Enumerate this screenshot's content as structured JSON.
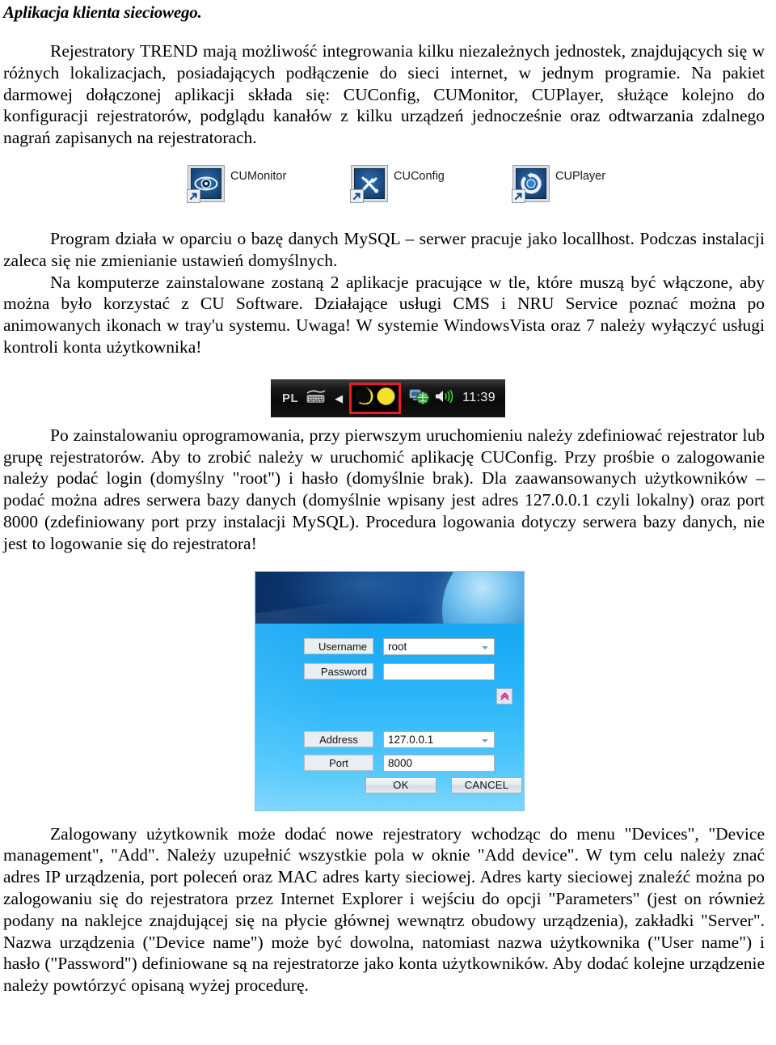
{
  "document": {
    "title": "Aplikacja klienta sieciowego.",
    "paragraphs": {
      "p1": "Rejestratory TREND mają możliwość integrowania kilku niezależnych jednostek, znajdujących się w różnych lokalizacjach, posiadających podłączenie do sieci internet, w jednym programie. Na pakiet darmowej dołączonej aplikacji składa się: CUConfig, CUMonitor, CUPlayer, służące kolejno do konfiguracji rejestratorów, podglądu kanałów z kilku urządzeń jednocześnie oraz odtwarzania zdalnego nagrań zapisanych na rejestratorach.",
      "p2": "Program działa w oparciu o bazę danych MySQL – serwer pracuje jako locallhost. Podczas instalacji zaleca się nie zmienianie ustawień domyślnych.",
      "p3": "Na komputerze zainstalowane zostaną 2 aplikacje pracujące w tle, które muszą być włączone, aby można było korzystać z CU Software. Działające usługi CMS i NRU Service poznać można po animowanych ikonach w tray'u systemu. Uwaga! W systemie WindowsVista oraz 7 należy wyłączyć usługi kontroli konta użytkownika!",
      "p4": "Po zainstalowaniu oprogramowania, przy pierwszym uruchomieniu należy zdefiniować rejestrator lub grupę rejestratorów. Aby to zrobić należy w uruchomić aplikację CUConfig. Przy prośbie o zalogowanie należy podać login (domyślny \"root\") i hasło (domyślnie brak). Dla zaawansowanych użytkowników – podać można adres serwera bazy danych (domyślnie wpisany jest adres 127.0.0.1 czyli lokalny) oraz port 8000 (zdefiniowany port przy instalacji MySQL). Procedura logowania dotyczy serwera bazy danych, nie jest to logowanie się do rejestratora!",
      "p5": "Zalogowany użytkownik może dodać nowe rejestratory wchodząc do menu \"Devices\", \"Device management\", \"Add\". Należy uzupełnić wszystkie pola w oknie \"Add device\". W tym celu należy znać adres IP urządzenia, port poleceń oraz MAC adres karty sieciowej. Adres karty sieciowej znaleźć można po zalogowaniu się do rejestratora przez Internet Explorer i wejściu do opcji \"Parameters\" (jest on również podany na naklejce znajdującej się na płycie głównej wewnątrz obudowy urządzenia), zakładki \"Server\". Nazwa urządzenia (\"Device name\") może być dowolna, natomiast nazwa użytkownika (\"User name\") i hasło (\"Password\") definiowane są na rejestratorze jako konta użytkowników. Aby dodać kolejne urządzenie należy powtórzyć opisaną wyżej procedurę."
    }
  },
  "shortcuts": [
    {
      "label": "CUMonitor",
      "icon": "eye-icon",
      "overlay": "shortcut-arrow-icon"
    },
    {
      "label": "CUConfig",
      "icon": "tools-icon",
      "overlay": "shortcut-arrow-icon"
    },
    {
      "label": "CUPlayer",
      "icon": "refresh-circle-icon",
      "overlay": "shortcut-arrow-icon"
    }
  ],
  "tray": {
    "language": "PL",
    "keyboard_icon": "keyboard-icon",
    "expand_icon": "chevron-left-icon",
    "highlighted_icons": [
      "cms-service-icon",
      "nru-service-icon"
    ],
    "network_icon": "network-icon",
    "volume_icon": "speaker-icon",
    "clock": "11:39",
    "highlight_color": "#ee1b24"
  },
  "login_dialog": {
    "fields": [
      {
        "label": "Username",
        "value": "root",
        "type": "combo",
        "placeholder": ""
      },
      {
        "label": "Password",
        "value": "",
        "type": "text",
        "placeholder": ""
      },
      {
        "label": "Address",
        "value": "127.0.0.1",
        "type": "combo",
        "placeholder": ""
      },
      {
        "label": "Port",
        "value": "8000",
        "type": "text",
        "placeholder": ""
      }
    ],
    "expander_icon": "double-chevron-up-icon",
    "expander_color": "#d6299b",
    "buttons": {
      "ok": "OK",
      "cancel": "CANCEL"
    },
    "accent_color": "#1ea2f0"
  }
}
